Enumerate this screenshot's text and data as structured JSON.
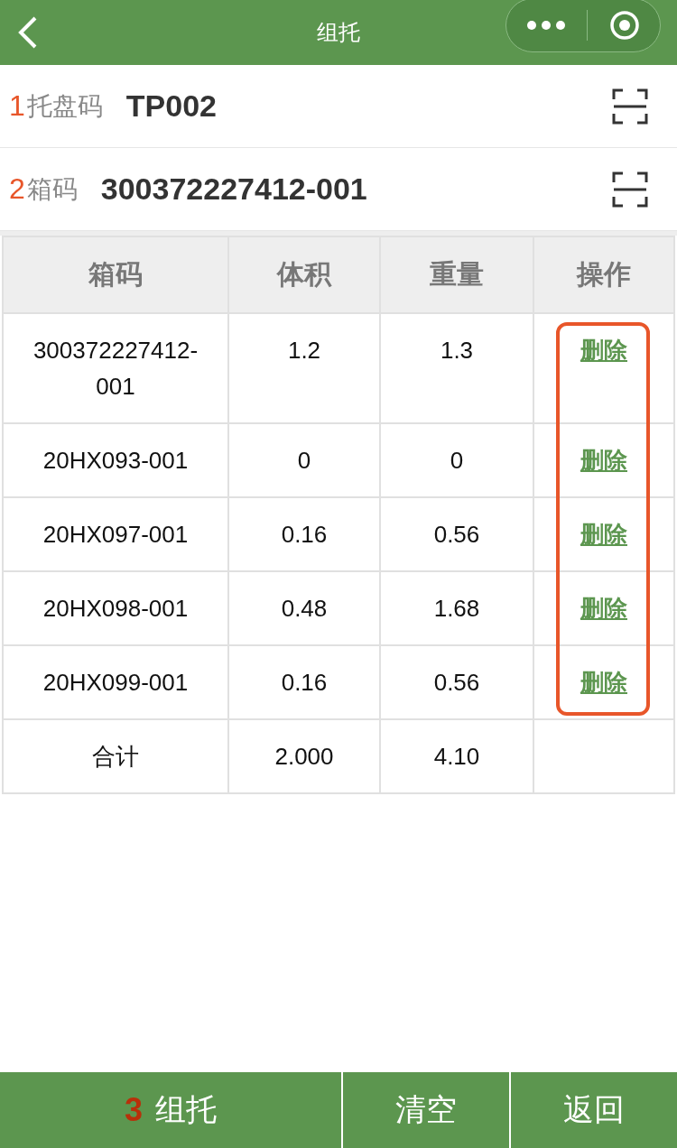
{
  "navbar": {
    "title": "组托"
  },
  "fields": [
    {
      "step": "1",
      "label": "托盘码",
      "value": "TP002"
    },
    {
      "step": "2",
      "label": "箱码",
      "value": "300372227412-001"
    }
  ],
  "table": {
    "columns": [
      "箱码",
      "体积",
      "重量",
      "操作"
    ],
    "rows": [
      {
        "cells": [
          "300372227412-001",
          "1.2",
          "1.3"
        ],
        "action": "删除"
      },
      {
        "cells": [
          "20HX093-001",
          "0",
          "0"
        ],
        "action": "删除"
      },
      {
        "cells": [
          "20HX097-001",
          "0.16",
          "0.56"
        ],
        "action": "删除"
      },
      {
        "cells": [
          "20HX098-001",
          "0.48",
          "1.68"
        ],
        "action": "删除"
      },
      {
        "cells": [
          "20HX099-001",
          "0.16",
          "0.56"
        ],
        "action": "删除"
      }
    ],
    "total": {
      "label": "合计",
      "volume": "2.000",
      "weight": "4.10"
    }
  },
  "buttons": [
    {
      "step": "3",
      "label": "组托"
    },
    {
      "label": "清空"
    },
    {
      "label": "返回"
    }
  ]
}
